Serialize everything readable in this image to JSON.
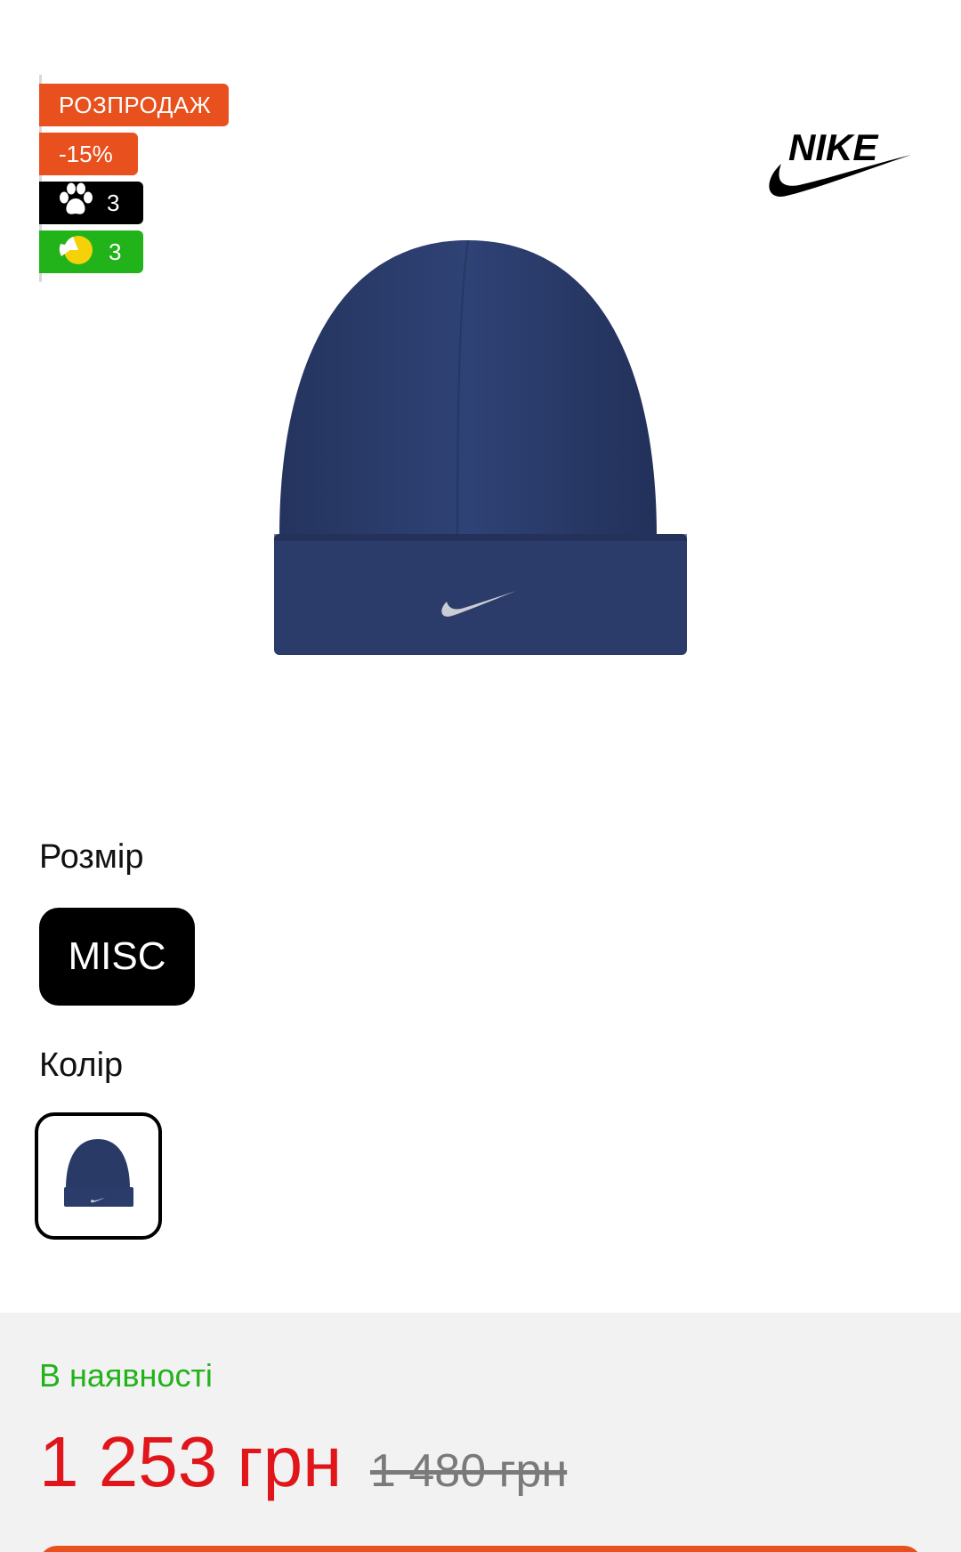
{
  "badges": {
    "sale": "РОЗПРОДАЖ",
    "discount": "-15%",
    "paws_count": "3",
    "pie_count": "3"
  },
  "brand": {
    "logo_text": "NIKE",
    "icon": "nike-swoosh-logo"
  },
  "product": {
    "image_icon": "navy-beanie-hat"
  },
  "size": {
    "label": "Розмір",
    "selected": "MISC"
  },
  "color": {
    "label": "Колір",
    "swatch_icon": "navy-beanie-thumbnail"
  },
  "purchase": {
    "stock_status": "В наявності",
    "price": "1 253 грн",
    "old_price": "1 480 грн"
  },
  "colors": {
    "accent_orange": "#e8501e",
    "stock_green": "#22b21a",
    "price_red": "#e0161b",
    "hat_navy": "#2a3a66"
  }
}
